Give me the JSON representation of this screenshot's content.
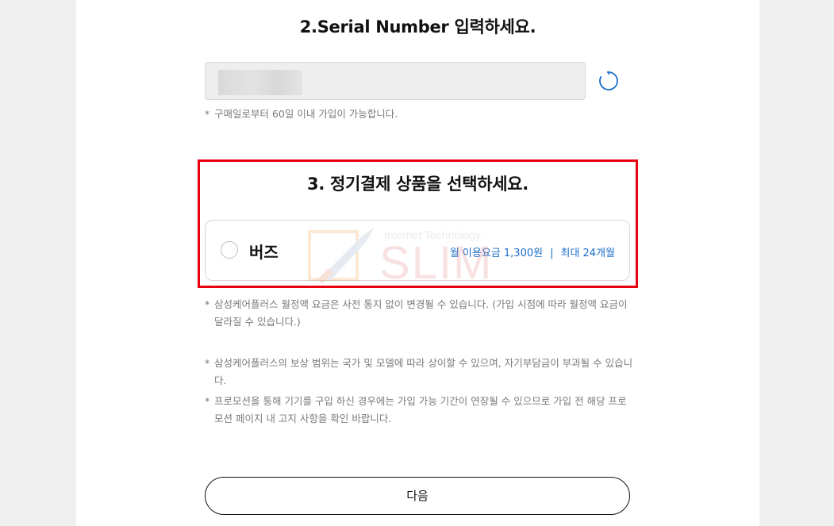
{
  "serial_section": {
    "title": "2.Serial Number 입력하세요.",
    "input_value": "",
    "note_star": "*",
    "note": "구매일로부터 60일 이내 가입이 가능합니다."
  },
  "plan_section": {
    "title": "3. 정기결제 상품을 선택하세요.",
    "plan": {
      "name": "버즈",
      "price": "월 이용요금 1,300원",
      "separator": "|",
      "duration": "최대 24개월"
    }
  },
  "watermark": {
    "top_text": "Internet Technology",
    "main_text": "SLIM"
  },
  "notes": [
    "삼성케어플러스 월정액 요금은 사전 통지 없이 변경될 수 있습니다. (가입 시점에 따라 월정액 요금이 달라질 수 있습니다.)",
    "삼성케어플러스의 보상 범위는 국가 및 모델에 따라 상이할 수 있으며, 자기부담금이 부과될 수 있습니다.",
    "프로모션을 통해 기기를 구입 하신 경우에는 가입 가능 기간이 연장될 수 있으므로 가입 전 해당 프로모션 페이지 내 고지 사항을 확인 바랍니다."
  ],
  "note_star": "*",
  "next_button": {
    "label": "다음"
  },
  "colors": {
    "highlight_border": "#e8000f",
    "link_blue": "#1a6ec8"
  },
  "icons": {
    "refresh": "refresh-icon",
    "radio": "radio-unchecked"
  }
}
